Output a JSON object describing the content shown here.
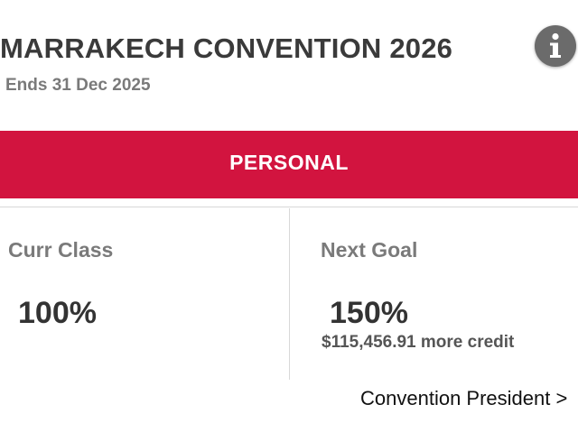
{
  "header": {
    "title": "MARRAKECH CONVENTION 2026",
    "subtitle": "Ends 31 Dec 2025",
    "info_icon": "info-circle-icon"
  },
  "banner": {
    "label": "PERSONAL",
    "color": "#d2143f"
  },
  "current": {
    "label": "Curr Class",
    "value": "100%"
  },
  "next": {
    "label": "Next Goal",
    "value": "150%",
    "credit_text": "$115,456.91 more credit"
  },
  "link": {
    "label": "Convention President >"
  }
}
